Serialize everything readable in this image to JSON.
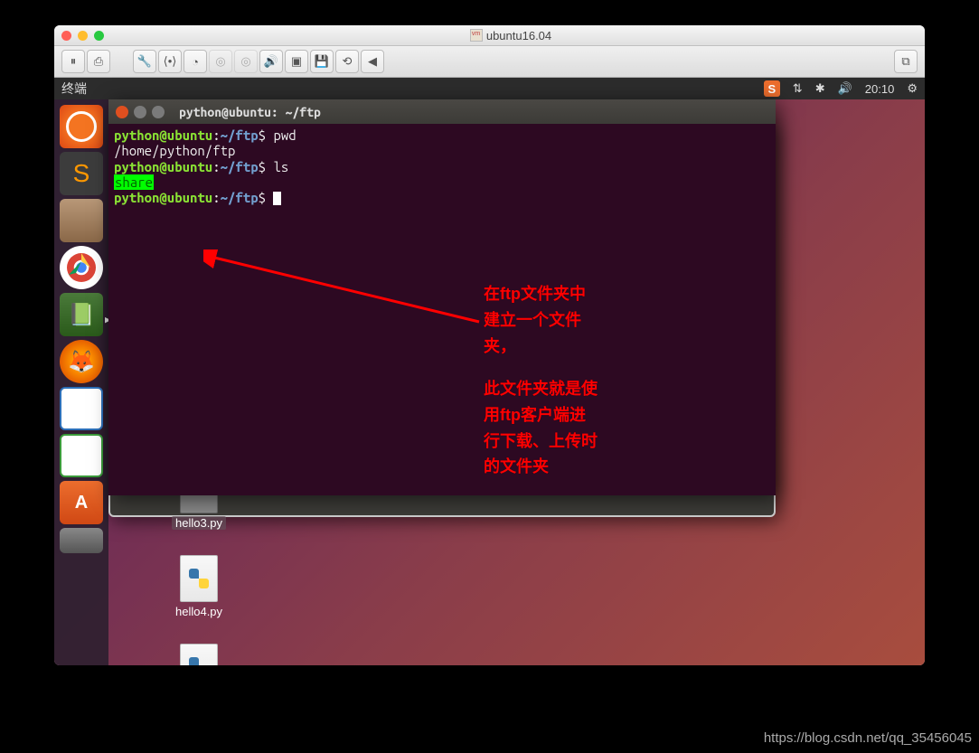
{
  "window": {
    "title": "ubuntu16.04"
  },
  "ubuntu": {
    "topbar_app": "终端",
    "time": "20:10",
    "sogou": "S"
  },
  "desktop": {
    "files": [
      {
        "name": "hello3.py"
      },
      {
        "name": "hello4.py"
      },
      {
        "name": ""
      }
    ]
  },
  "terminal": {
    "title": "python@ubuntu: ~/ftp",
    "prompt_user": "python@ubuntu",
    "prompt_path": "~/ftp",
    "cmd1": "pwd",
    "out1": "/home/python/ftp",
    "cmd2": "ls",
    "out2": "share"
  },
  "annotations": {
    "block1_l1": "在ftp文件夹中",
    "block1_l2": "建立一个文件",
    "block1_l3": "夹，",
    "block2_l1": "此文件夹就是使",
    "block2_l2": "用ftp客户端进",
    "block2_l3": "行下载、上传时",
    "block2_l4": "的文件夹"
  },
  "watermark": "https://blog.csdn.net/qq_35456045"
}
